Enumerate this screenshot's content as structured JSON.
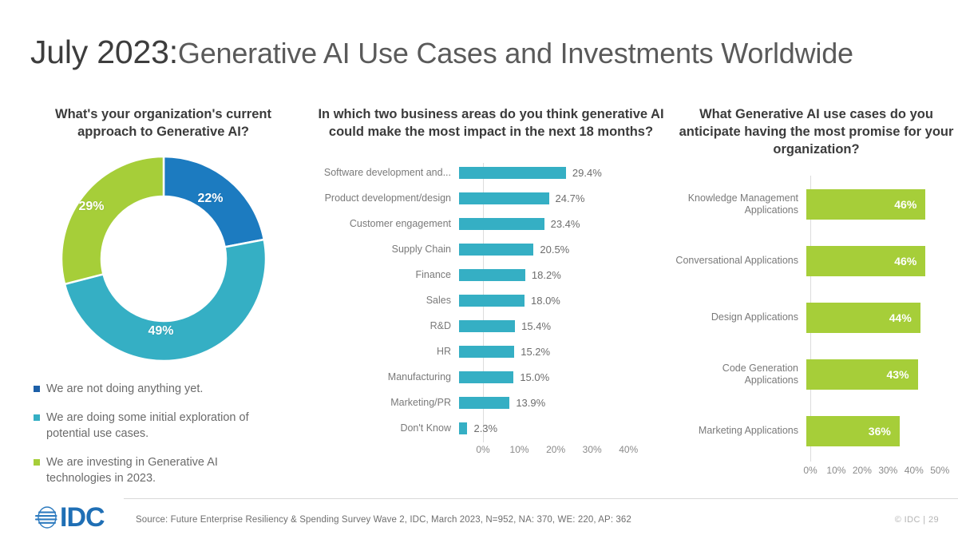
{
  "slide": {
    "title_strong": "July 2023:",
    "title_rest": "Generative AI Use Cases and Investments Worldwide"
  },
  "colors": {
    "dark_blue": "#1C7BC0",
    "cyan": "#35AFC4",
    "green": "#A6CE39",
    "text_dark": "#3b3b3b",
    "text_muted": "#7a7a7a"
  },
  "panels": {
    "approach": {
      "title": "What's your organization's current approach to Generative AI?",
      "legend": [
        {
          "label": "We are not doing anything yet.",
          "color": "#1C5FA8"
        },
        {
          "label": "We are doing some initial exploration of potential use cases.",
          "color": "#35AFC4"
        },
        {
          "label": "We are investing in Generative AI technologies in 2023.",
          "color": "#A6CE39"
        }
      ]
    },
    "impact": {
      "title": "In which two business areas do you think generative AI could make the most impact in the next 18 months?"
    },
    "usecases": {
      "title": "What Generative AI use cases do you anticipate having the most promise for your organization?"
    }
  },
  "footer": {
    "logo_text": "IDC",
    "source": "Source: Future Enterprise Resiliency & Spending Survey Wave 2, IDC, March 2023, N=952, NA: 370, WE: 220, AP: 362",
    "copyright": "© IDC  |  29"
  },
  "chart_data": [
    {
      "type": "pie",
      "id": "approach-donut",
      "title": "What's your organization's current approach to Generative AI?",
      "donut": true,
      "labels": [
        "We are not doing anything yet.",
        "We are doing some initial exploration of potential use cases.",
        "We are investing in Generative AI technologies in 2023."
      ],
      "values": [
        22,
        49,
        29
      ],
      "value_labels": [
        "22%",
        "49%",
        "29%"
      ],
      "colors": [
        "#1C7BC0",
        "#35AFC4",
        "#A6CE39"
      ],
      "legend_position": "bottom-left",
      "start_angle": 0
    },
    {
      "type": "bar",
      "id": "impact-bars",
      "orientation": "horizontal",
      "title": "In which two business areas do you think generative AI could make the most impact in the next 18 months?",
      "categories": [
        "Software development and...",
        "Product development/design",
        "Customer engagement",
        "Supply Chain",
        "Finance",
        "Sales",
        "R&D",
        "HR",
        "Manufacturing",
        "Marketing/PR",
        "Don't Know"
      ],
      "values": [
        29.4,
        24.7,
        23.4,
        20.5,
        18.2,
        18.0,
        15.4,
        15.2,
        15.0,
        13.9,
        2.3
      ],
      "value_labels": [
        "29.4%",
        "24.7%",
        "23.4%",
        "20.5%",
        "18.2%",
        "18.0%",
        "15.4%",
        "15.2%",
        "15.0%",
        "13.9%",
        "2.3%"
      ],
      "color": "#35AFC4",
      "xlabel": "",
      "ylabel": "",
      "xlim": [
        0,
        45
      ],
      "xticks": [
        0,
        10,
        20,
        30,
        40
      ],
      "xtick_labels": [
        "0%",
        "10%",
        "20%",
        "30%",
        "40%"
      ],
      "grid": false,
      "labels_inside": false
    },
    {
      "type": "bar",
      "id": "usecase-bars",
      "orientation": "horizontal",
      "title": "What Generative AI use cases do you anticipate having the most promise for your organization?",
      "categories": [
        "Knowledge Management Applications",
        "Conversational Applications",
        "Design Applications",
        "Code Generation Applications",
        "Marketing Applications"
      ],
      "values": [
        46,
        46,
        44,
        43,
        36
      ],
      "value_labels": [
        "46%",
        "46%",
        "44%",
        "43%",
        "36%"
      ],
      "color": "#A6CE39",
      "xlabel": "",
      "ylabel": "",
      "xlim": [
        0,
        53
      ],
      "xticks": [
        0,
        10,
        20,
        30,
        40,
        50
      ],
      "xtick_labels": [
        "0%",
        "10%",
        "20%",
        "30%",
        "40%",
        "50%"
      ],
      "grid": false,
      "labels_inside": true
    }
  ]
}
